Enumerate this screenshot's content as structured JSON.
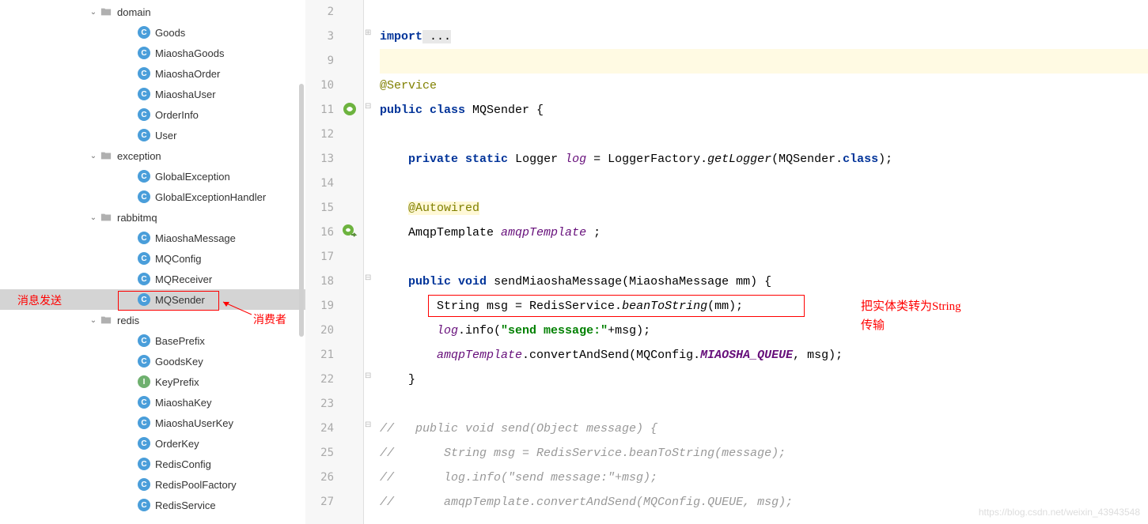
{
  "tree": {
    "domain": {
      "label": "domain",
      "children": [
        "Goods",
        "MiaoshaGoods",
        "MiaoshaOrder",
        "MiaoshaUser",
        "OrderInfo",
        "User"
      ]
    },
    "exception": {
      "label": "exception",
      "children": [
        "GlobalException",
        "GlobalExceptionHandler"
      ]
    },
    "rabbitmq": {
      "label": "rabbitmq",
      "children": [
        "MiaoshaMessage",
        "MQConfig",
        "MQReceiver",
        "MQSender"
      ]
    },
    "redis": {
      "label": "redis",
      "children": [
        "BasePrefix",
        "GoodsKey",
        "KeyPrefix",
        "MiaoshaKey",
        "MiaoshaUserKey",
        "OrderKey",
        "RedisConfig",
        "RedisPoolFactory",
        "RedisService"
      ]
    }
  },
  "icons": {
    "redis_interface_index": 2
  },
  "annotations": {
    "left1": "消息发送",
    "left2": "消费者",
    "right1": "把实体类转为String",
    "right2": "传输"
  },
  "gutter_numbers": [
    "2",
    "3",
    "9",
    "10",
    "11",
    "12",
    "13",
    "14",
    "15",
    "16",
    "17",
    "18",
    "19",
    "20",
    "21",
    "22",
    "23",
    "24",
    "25",
    "26",
    "27"
  ],
  "code": {
    "import_kw": "import",
    "import_dots": " ...",
    "service": "@Service",
    "public": "public",
    "class": "class",
    "clsname": " MQSender {",
    "private": "private",
    "static": "static",
    "logger_type": " Logger ",
    "log_field": "log",
    "eq": " = LoggerFactory.",
    "getLogger": "getLogger",
    "logger_arg": "(MQSender.",
    "class_kw2": "class",
    "close_paren": ");",
    "autowired": "@Autowired",
    "amqp_type": "AmqpTemplate ",
    "amqp_field": "amqpTemplate",
    "amqp_end": " ;",
    "void": "void",
    "method_name": " sendMiaoshaMessage(MiaoshaMessage mm) {",
    "line19_a": "String msg = RedisService.",
    "bean2str": "beanToString",
    "line19_b": "(mm);",
    "log_call": "log",
    "info": ".info(",
    "sendmsg_str": "\"send message:\"",
    "plus_msg": "+msg);",
    "amqp_call": "amqpTemplate",
    "convert": ".convertAndSend(MQConfig.",
    "queue": "MIAOSHA_QUEUE",
    "convert_end": ", msg);",
    "close_brace": "}",
    "c24": "//   public void send(Object message) {",
    "c25": "//       String msg = RedisService.beanToString(message);",
    "c26": "//       log.info(\"send message:\"+msg);",
    "c27": "//       amqpTemplate.convertAndSend(MQConfig.QUEUE, msg);"
  },
  "watermark": "https://blog.csdn.net/weixin_43943548"
}
